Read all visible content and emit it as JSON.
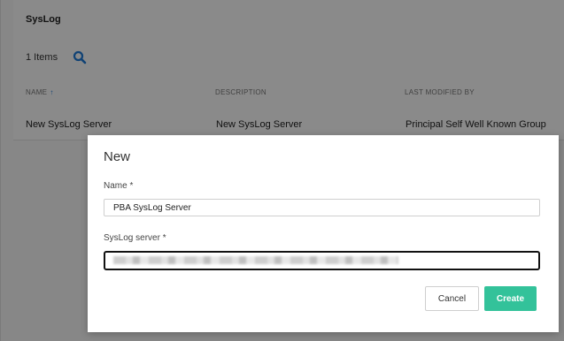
{
  "header": {
    "title": "SysLog"
  },
  "toolbar": {
    "item_count": "1 Items",
    "search_icon": "search-icon"
  },
  "table": {
    "columns": [
      {
        "label": "NAME",
        "sort": "ascending",
        "sort_icon": "arrow-up-icon"
      },
      {
        "label": "DESCRIPTION"
      },
      {
        "label": "LAST MODIFIED BY"
      }
    ],
    "rows": [
      {
        "name": "New SysLog Server",
        "description": "New SysLog Server",
        "last_modified_by": "Principal Self Well Known Group"
      }
    ]
  },
  "dialog": {
    "title": "New",
    "name_label": "Name *",
    "name_value": "PBA SysLog Server",
    "server_label": "SysLog server *",
    "server_value": "",
    "server_value_redacted": true,
    "cancel_label": "Cancel",
    "create_label": "Create"
  },
  "colors": {
    "accent": "#1e7bd8",
    "create_button": "#33c29a",
    "overlay": "rgba(0,0,0,0.46)"
  }
}
